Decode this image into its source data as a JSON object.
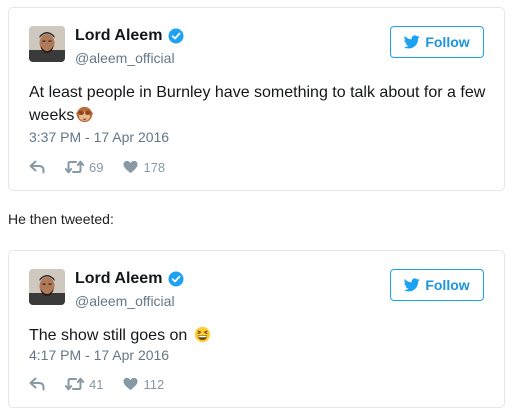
{
  "tweets": [
    {
      "display_name": "Lord Aleem",
      "handle": "@aleem_official",
      "follow_label": "Follow",
      "text": "At least people in Burnley have something to talk about for a few weeks",
      "emoji": "see-no-evil-monkey",
      "timestamp": "3:37 PM - 17 Apr 2016",
      "retweets": "69",
      "likes": "178"
    },
    {
      "display_name": "Lord Aleem",
      "handle": "@aleem_official",
      "follow_label": "Follow",
      "text": "The show still goes on",
      "emoji": "grinning-squinting-face",
      "timestamp": "4:17 PM - 17 Apr 2016",
      "retweets": "41",
      "likes": "112"
    }
  ],
  "between_text": "He then tweeted:",
  "colors": {
    "twitter_blue": "#1da1f2",
    "verified_blue": "#1da1f2",
    "meta_gray": "#657786",
    "icon_gray": "#8899a6",
    "border": "#e1e8ed"
  }
}
